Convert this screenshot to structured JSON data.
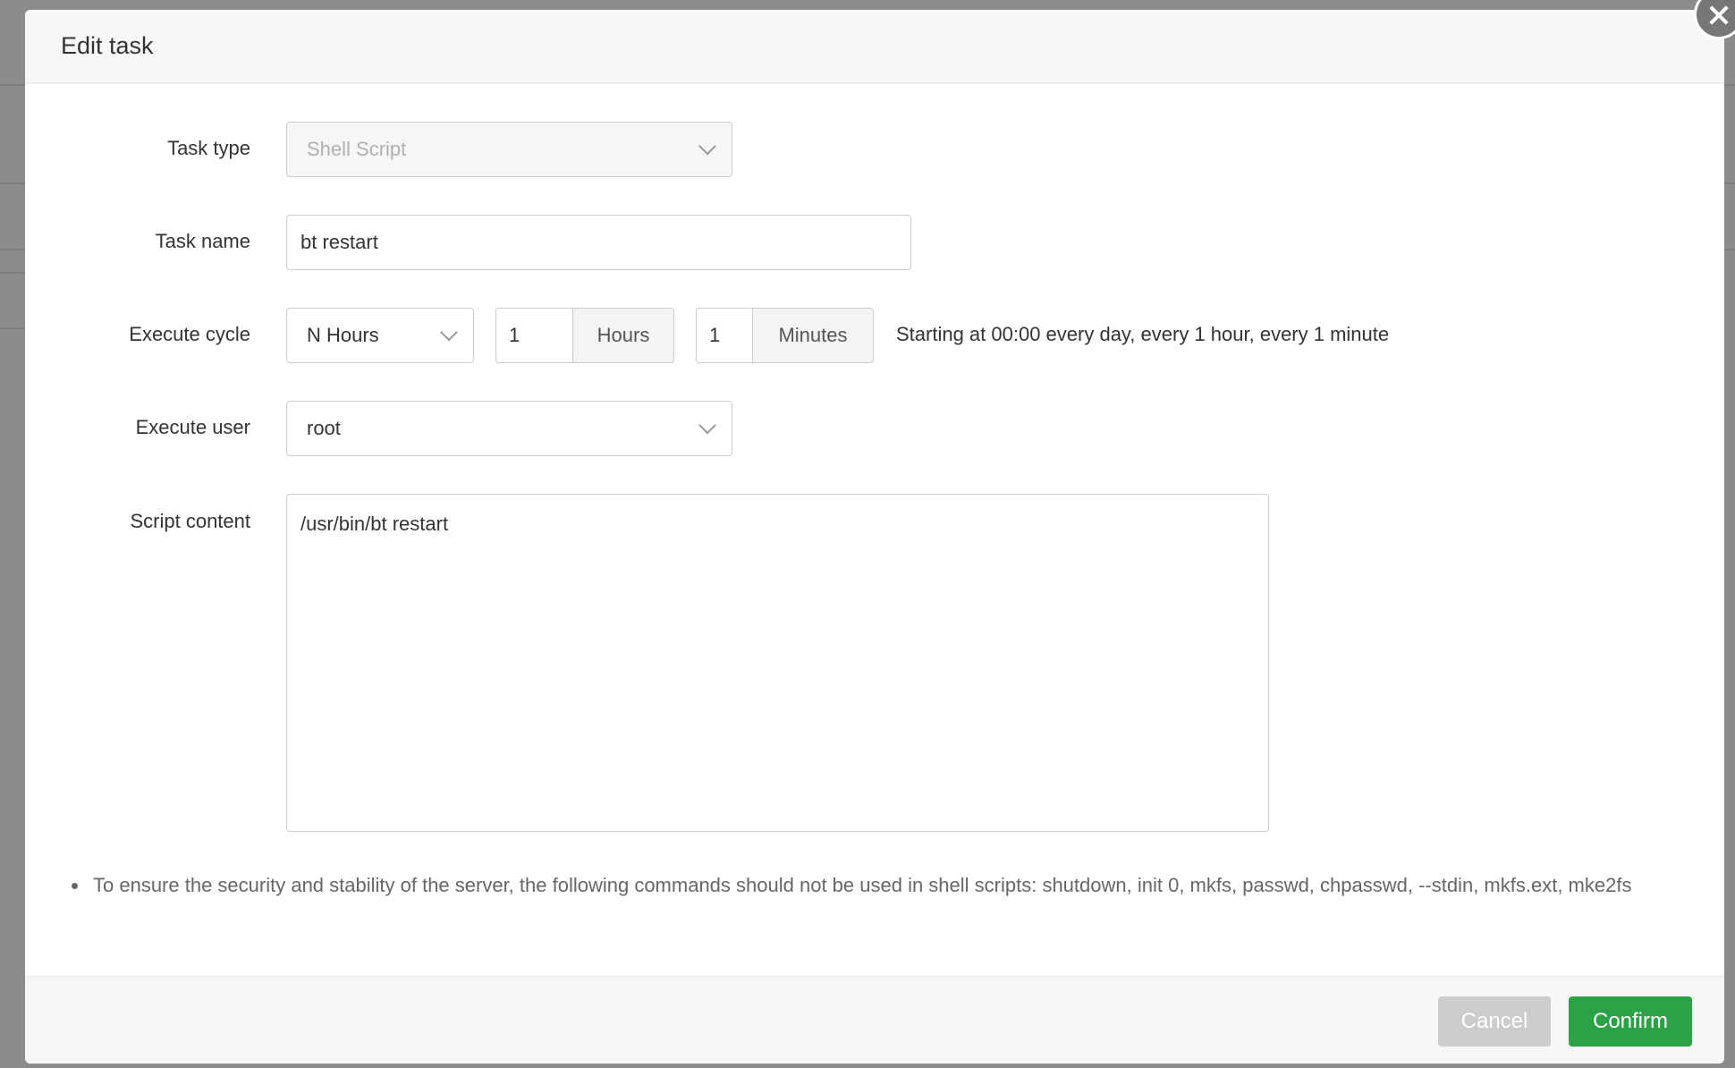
{
  "dialog": {
    "title": "Edit task",
    "task_type": {
      "label": "Task type",
      "value": "Shell Script"
    },
    "task_name": {
      "label": "Task name",
      "value": "bt restart"
    },
    "execute_cycle": {
      "label": "Execute cycle",
      "cycle": "N Hours",
      "hours": "1",
      "hours_unit": "Hours",
      "minutes": "1",
      "minutes_unit": "Minutes",
      "description": "Starting at 00:00 every day, every 1 hour, every 1 minute"
    },
    "execute_user": {
      "label": "Execute user",
      "value": "root"
    },
    "script_content": {
      "label": "Script content",
      "value": "/usr/bin/bt restart"
    },
    "note": "To ensure the security and stability of the server, the following commands should not be used in shell scripts: shutdown, init 0, mkfs, passwd, chpasswd, --stdin, mkfs.ext, mke2fs",
    "cancel_label": "Cancel",
    "confirm_label": "Confirm"
  },
  "colors": {
    "confirm": "#2ba245",
    "cancel": "#cccccc"
  }
}
